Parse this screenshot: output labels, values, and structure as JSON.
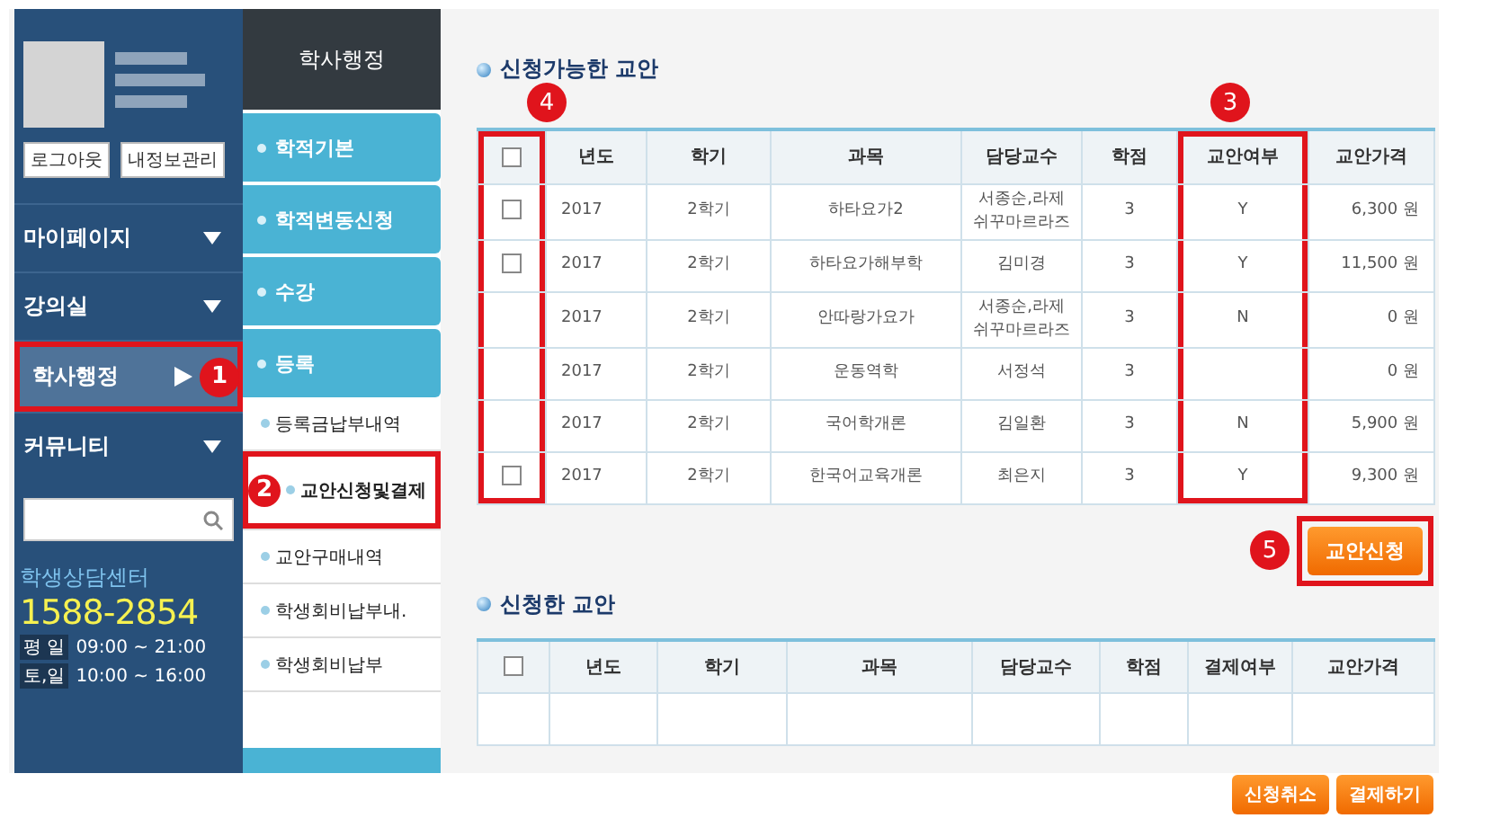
{
  "sidebar": {
    "account_buttons": [
      "로그아웃",
      "내정보관리"
    ],
    "menu": [
      {
        "label": "마이페이지",
        "selected": false
      },
      {
        "label": "강의실",
        "selected": false
      },
      {
        "label": "학사행정",
        "selected": true,
        "callout": "1"
      },
      {
        "label": "커뮤니티",
        "selected": false
      }
    ],
    "help": {
      "title": "학생상담센터",
      "phone": "1588-2854",
      "hours": [
        {
          "day": "평 일",
          "time": "09:00 ~ 21:00"
        },
        {
          "day": "토,일",
          "time": "10:00 ~ 16:00"
        }
      ]
    }
  },
  "submenu": {
    "title": "학사행정",
    "sections": [
      "학적기본",
      "학적변동신청",
      "수강",
      "등록"
    ],
    "items": [
      {
        "label": "등록금납부내역",
        "selected": false
      },
      {
        "label": "교안신청및결제",
        "selected": true,
        "callout": "2"
      },
      {
        "label": "교안구매내역",
        "selected": false
      },
      {
        "label": "학생회비납부내.",
        "selected": false
      },
      {
        "label": "학생회비납부",
        "selected": false
      }
    ]
  },
  "available": {
    "title": "신청가능한 교안",
    "header_checked": false,
    "flag_callout": "3",
    "check_callout": "4",
    "columns": [
      "년도",
      "학기",
      "과목",
      "담당교수",
      "학점",
      "교안여부",
      "교안가격"
    ],
    "rows": [
      {
        "checked": false,
        "cells": [
          "2017",
          "2학기",
          "하타요가2",
          "서종순,라제\n쉬꾸마르라즈",
          "3",
          "Y",
          "6,300 원"
        ]
      },
      {
        "checked": false,
        "cells": [
          "2017",
          "2학기",
          "하타요가해부학",
          "김미경",
          "3",
          "Y",
          "11,500 원"
        ]
      },
      {
        "cells": [
          "2017",
          "2학기",
          "안따랑가요가",
          "서종순,라제\n쉬꾸마르라즈",
          "3",
          "N",
          "0 원"
        ]
      },
      {
        "cells": [
          "2017",
          "2학기",
          "운동역학",
          "서정석",
          "3",
          "",
          "0 원"
        ]
      },
      {
        "cells": [
          "2017",
          "2학기",
          "국어학개론",
          "김일환",
          "3",
          "N",
          "5,900 원"
        ]
      },
      {
        "checked": false,
        "cells": [
          "2017",
          "2학기",
          "한국어교육개론",
          "최은지",
          "3",
          "Y",
          "9,300 원"
        ]
      }
    ]
  },
  "apply_button": {
    "label": "교안신청",
    "callout": "5"
  },
  "applied": {
    "title": "신청한 교안",
    "header_checked": false,
    "columns": [
      "년도",
      "학기",
      "과목",
      "담당교수",
      "학점",
      "결제여부",
      "교안가격"
    ]
  },
  "buttons": [
    "신청취소",
    "결제하기"
  ]
}
